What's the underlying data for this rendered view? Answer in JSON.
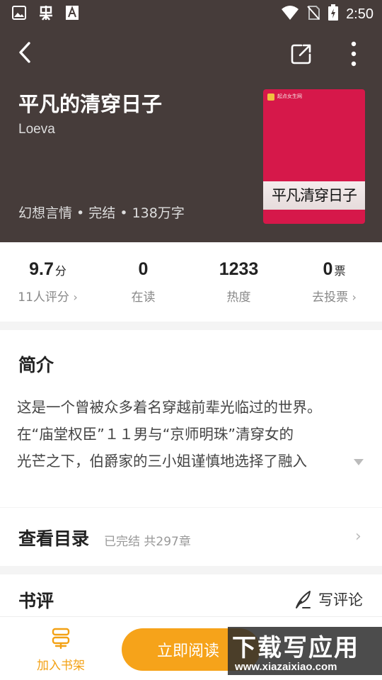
{
  "status_bar": {
    "time": "2:50",
    "left_icons": [
      "image-icon",
      "bug-icon",
      "text-a-icon"
    ],
    "right_icons": [
      "wifi-icon",
      "no-sim-icon",
      "battery-charging-icon"
    ]
  },
  "top_bar": {
    "icons": [
      "back-arrow-icon",
      "share-icon",
      "more-vertical-icon"
    ]
  },
  "book": {
    "title": "平凡的清穿日子",
    "author": "Loeva",
    "meta": "幻想言情 • 完结 • 138万字",
    "cover": {
      "brand": "起点女生网",
      "calligraphy": "平凡清穿日子",
      "color": "#d6184a"
    }
  },
  "stats": [
    {
      "value": "9.7",
      "unit": "分",
      "label": "11人评分",
      "chevron": "›"
    },
    {
      "value": "0",
      "unit": "",
      "label": "在读",
      "chevron": ""
    },
    {
      "value": "1233",
      "unit": "",
      "label": "热度",
      "chevron": ""
    },
    {
      "value": "0",
      "unit": "票",
      "label": "去投票",
      "chevron": "›"
    }
  ],
  "intro": {
    "title": "简介",
    "lines": [
      "这是一个曾被众多着名穿越前辈光临过的世界。",
      "在“庙堂权臣”１１男与“京师明珠”清穿女的",
      "光芒之下，伯爵家的三小姐谨慎地选择了融入"
    ]
  },
  "catalog": {
    "title": "查看目录",
    "subtitle": "已完结 共297章",
    "chevron": "›"
  },
  "reviews": {
    "title": "书评",
    "write_label": "写评论"
  },
  "bottom_bar": {
    "shelf_label": "加入书架",
    "read_label": "立即阅读"
  },
  "watermark": {
    "main": "下载写应用",
    "sub": "www.xiazaixiao.com"
  },
  "colors": {
    "header_bg": "#463c3a",
    "accent": "#f6a31a"
  }
}
